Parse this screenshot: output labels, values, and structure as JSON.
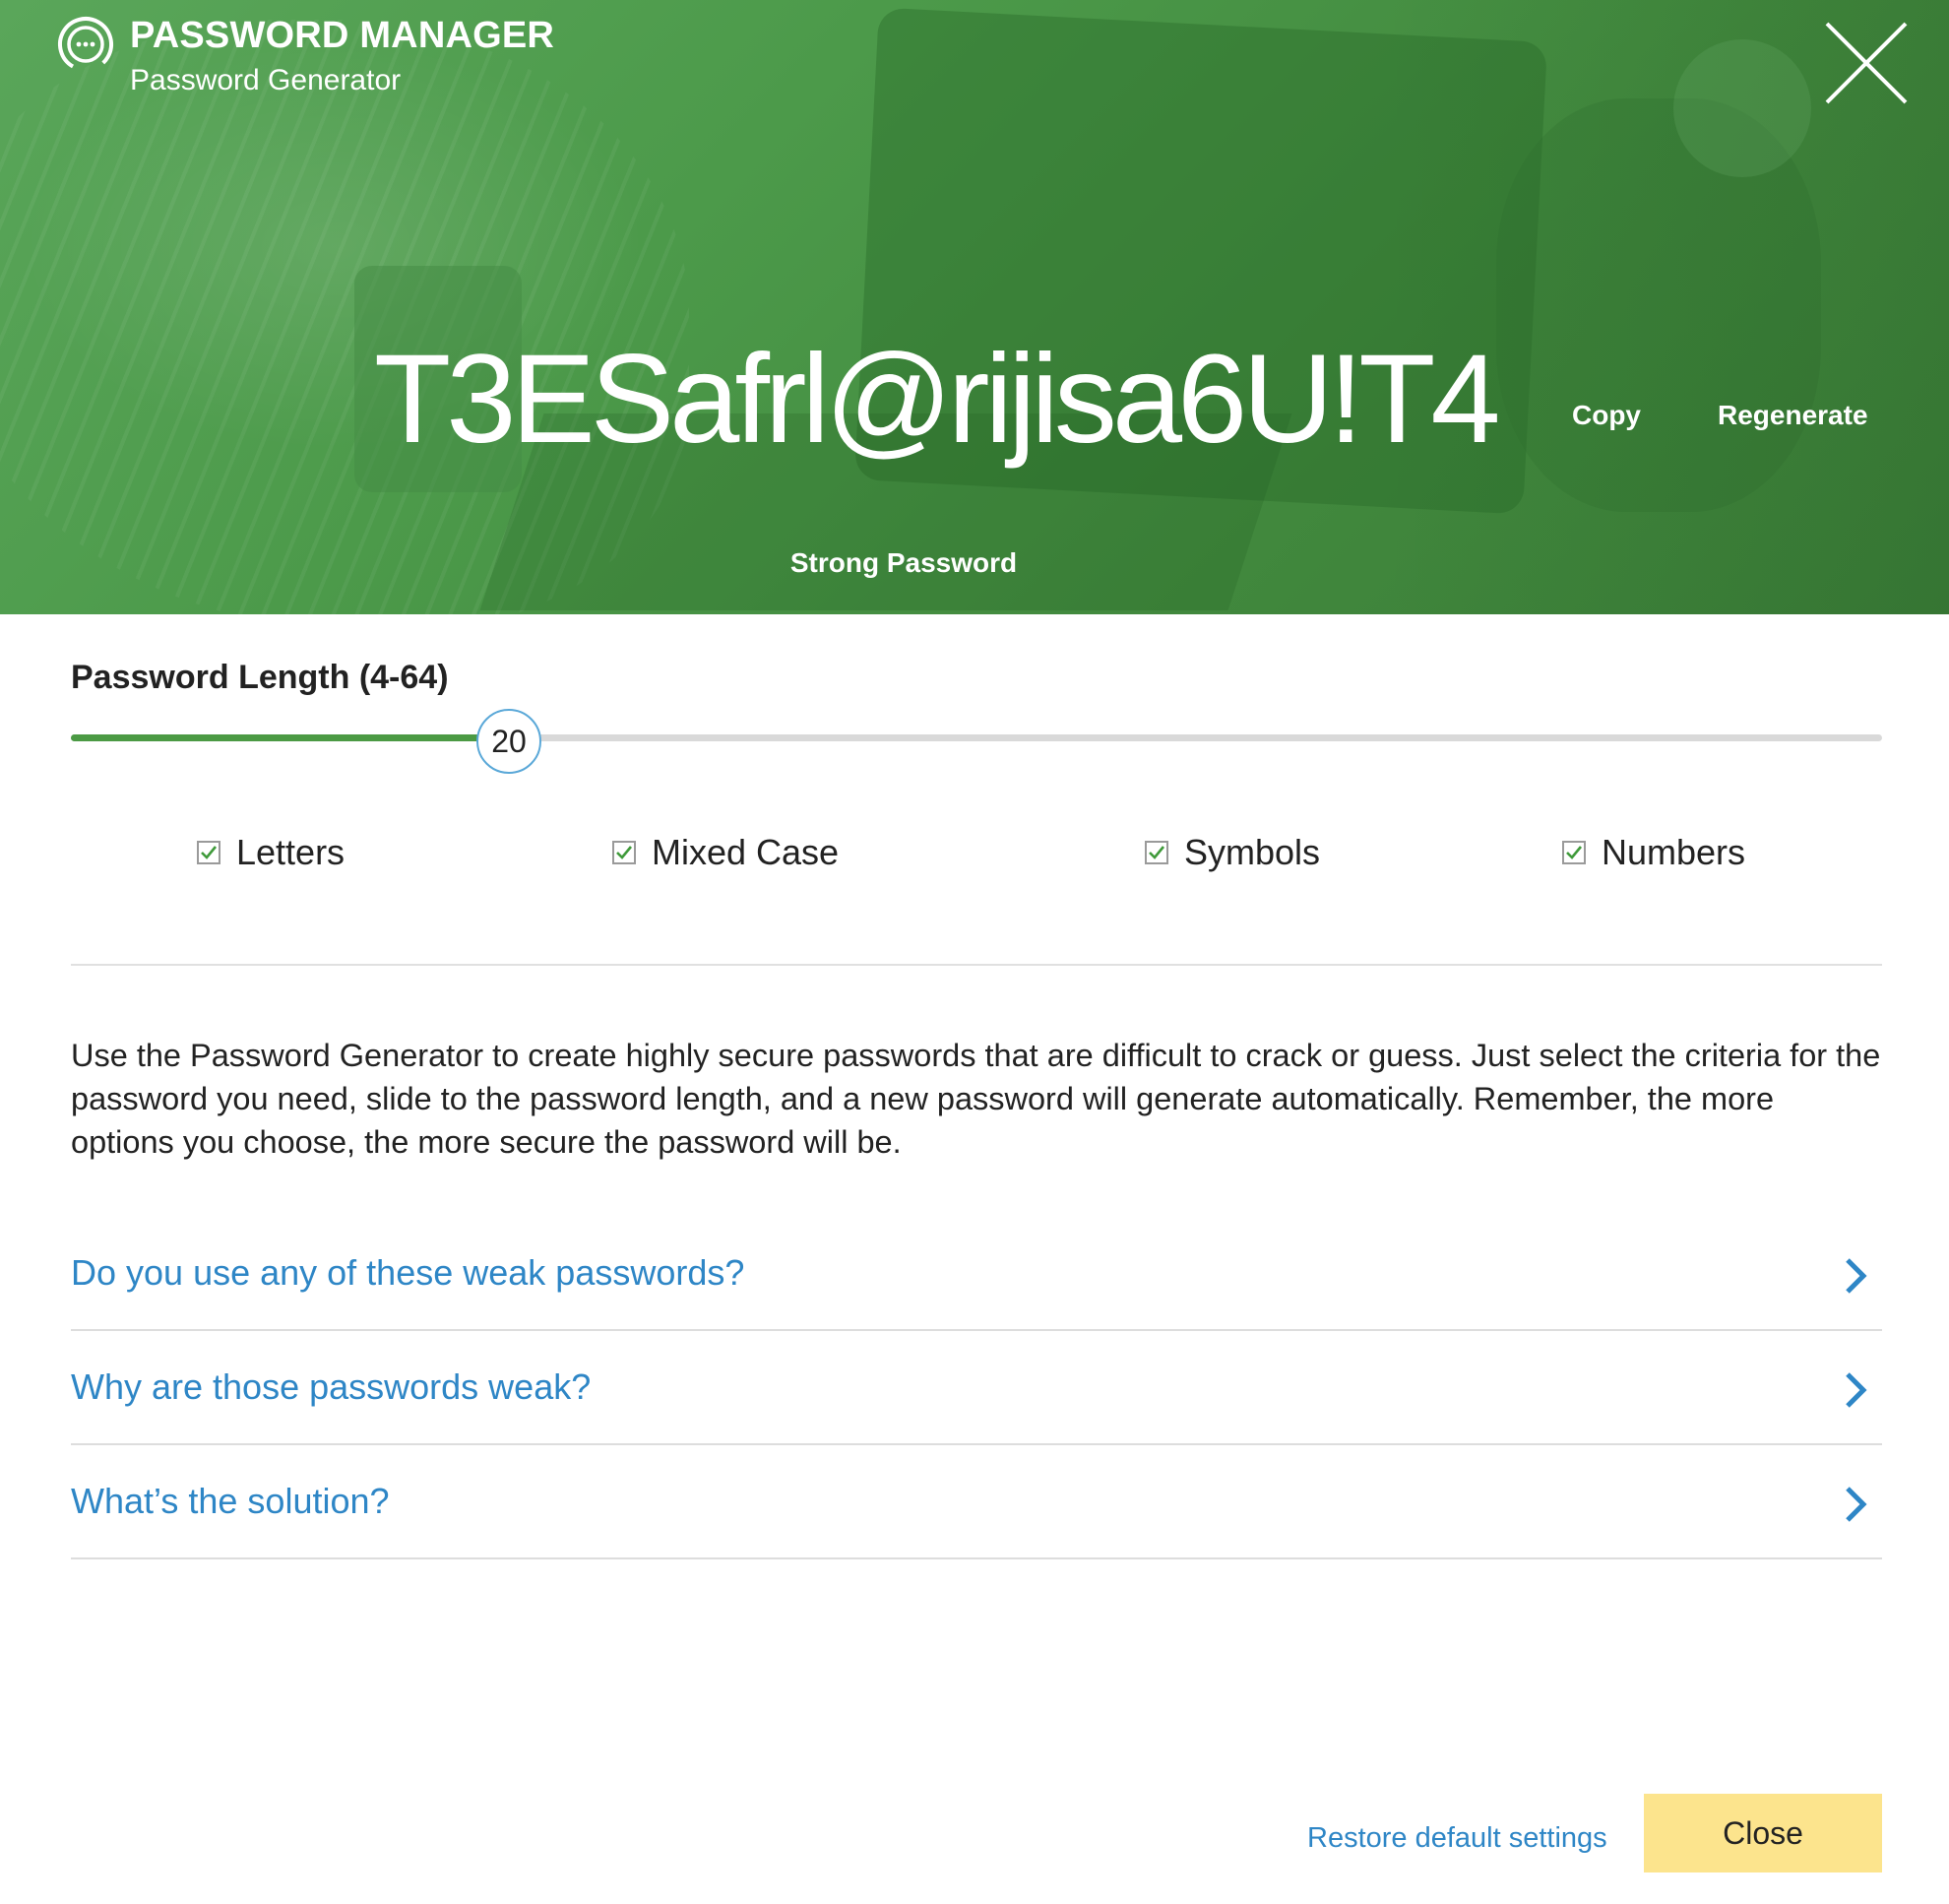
{
  "app": {
    "title": "PASSWORD MANAGER",
    "subtitle": "Password Generator",
    "logo_icon": "password-manager-logo-icon",
    "close_icon": "close-x-icon"
  },
  "generator": {
    "password": "T3ESafrl@rijisa6U!T4",
    "copy_label": "Copy",
    "regenerate_label": "Regenerate",
    "strength_label": "Strong Password"
  },
  "length": {
    "label": "Password Length (4-64)",
    "value": "20",
    "min": 4,
    "max": 64
  },
  "options": [
    {
      "label": "Letters",
      "checked": true
    },
    {
      "label": "Mixed Case",
      "checked": true
    },
    {
      "label": "Symbols",
      "checked": true
    },
    {
      "label": "Numbers",
      "checked": true
    }
  ],
  "description": "Use the Password Generator to create highly secure passwords that are difficult to crack or guess. Just select the criteria for the password you need, slide to the password length, and a new password will generate automatically. Remember, the more options you choose, the more secure the password will be.",
  "faq": [
    {
      "label": "Do you use any of these weak passwords?"
    },
    {
      "label": "Why are those passwords weak?"
    },
    {
      "label": "What’s the solution?"
    }
  ],
  "footer": {
    "restore_label": "Restore default settings",
    "close_label": "Close"
  },
  "colors": {
    "header_green": "#4c9a4a",
    "slider_fill": "#4b9a44",
    "slider_thumb_border": "#5aa8d8",
    "link_blue": "#2e86c6",
    "close_button": "#fce48d",
    "check_green": "#3f9a3a"
  }
}
